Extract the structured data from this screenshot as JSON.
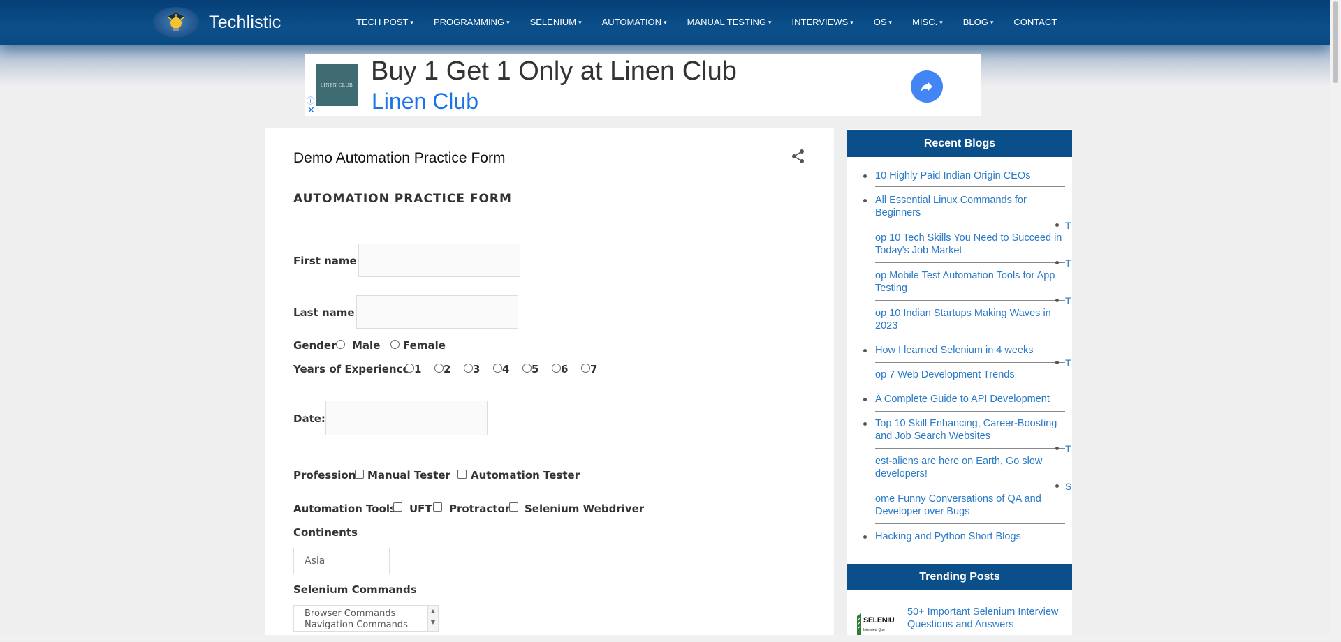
{
  "site": {
    "name": "Techlistic"
  },
  "nav": [
    {
      "label": "TECH POST",
      "caret": "▾"
    },
    {
      "label": "PROGRAMMING",
      "caret": "▾"
    },
    {
      "label": "SELENIUM",
      "caret": "▾"
    },
    {
      "label": "AUTOMATION",
      "caret": "▾"
    },
    {
      "label": "MANUAL TESTING",
      "caret": "▾"
    },
    {
      "label": "INTERVIEWS",
      "caret": "▾"
    },
    {
      "label": "OS",
      "caret": "▾"
    },
    {
      "label": "MISC.",
      "caret": "▾"
    },
    {
      "label": "BLOG",
      "caret": "▾"
    },
    {
      "label": "CONTACT",
      "caret": ""
    }
  ],
  "ad": {
    "logo_text": "LINEN CLUB",
    "headline": "Buy 1 Get 1 Only at Linen Club",
    "advertiser": "Linen Club",
    "info_icon": "ⓘ",
    "close_icon": "✕"
  },
  "post": {
    "title": "Demo Automation Practice Form"
  },
  "form": {
    "heading": "AUTOMATION PRACTICE FORM",
    "first_name_label": "First name:",
    "first_name_value": "",
    "last_name_label": "Last name:",
    "last_name_value": "",
    "gender_label": "Gender",
    "gender_options": [
      "Male",
      "Female"
    ],
    "experience_label": "Years of Experience",
    "experience_options": [
      "1",
      "2",
      "3",
      "4",
      "5",
      "6",
      "7"
    ],
    "date_label": "Date:",
    "date_value": "",
    "profession_label": "Profession",
    "profession_options": [
      "Manual Tester",
      "Automation Tester"
    ],
    "tools_label": "Automation Tools",
    "tools_options": [
      "UFT",
      "Protractor",
      "Selenium Webdriver"
    ],
    "continents_label": "Continents",
    "continents_selected": "Asia",
    "commands_label": "Selenium Commands",
    "commands_options": [
      "Browser Commands",
      "Navigation Commands"
    ]
  },
  "sidebar": {
    "recent_title": "Recent Blogs",
    "recent": [
      "10 Highly Paid Indian Origin CEOs",
      "All Essential Linux Commands for Beginners",
      "op 10 Tech Skills You Need to Succeed in Today's Job Market",
      "op Mobile Test Automation Tools for App Testing",
      "op 10 Indian Startups Making Waves in 2023",
      "How I learned Selenium in 4 weeks",
      "op 7 Web Development Trends",
      "A Complete Guide to API Development",
      "Top 10 Skill Enhancing, Career-Boosting and Job Search Websites",
      "est-aliens are here on Earth, Go slow developers!",
      "ome Funny Conversations of QA and Developer over Bugs",
      "Hacking and Python Short Blogs"
    ],
    "stray_letters": [
      "T",
      "T",
      "T",
      "T",
      "T",
      "S"
    ],
    "trending_title": "Trending Posts",
    "trending": [
      {
        "img_text": "SELENIU",
        "img_sub": "Interview Que",
        "title": "50+ Important Selenium Interview Questions and Answers"
      }
    ]
  }
}
